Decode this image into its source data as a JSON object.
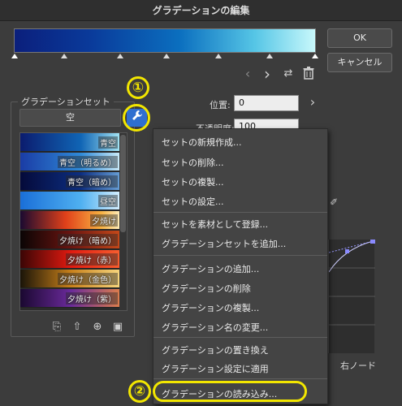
{
  "window": {
    "title": "グラデーションの編集"
  },
  "buttons": {
    "ok": "OK",
    "cancel": "キャンセル"
  },
  "toolbar_icons": [
    "chevron-left-icon",
    "chevron-right-icon",
    "swap-icon",
    "trash-icon"
  ],
  "gradient_set": {
    "label": "グラデーションセット",
    "selected_preset": "空",
    "items": [
      {
        "label": "青空"
      },
      {
        "label": "青空（明るめ）"
      },
      {
        "label": "青空（暗め）"
      },
      {
        "label": "昼空"
      },
      {
        "label": "夕焼け"
      },
      {
        "label": "夕焼け（暗め）"
      },
      {
        "label": "夕焼け（赤）"
      },
      {
        "label": "夕焼け（金色）"
      },
      {
        "label": "夕焼け（紫）"
      }
    ],
    "bottom_icons": [
      "duplicate-icon",
      "import-icon",
      "add-icon",
      "settings-icon"
    ]
  },
  "fields": {
    "position_label": "位置:",
    "position_value": "0",
    "opacity_label": "不透明度:",
    "opacity_value": "100"
  },
  "right_node_label": "右ノード",
  "context_menu": {
    "groups": [
      [
        "セットの新規作成...",
        "セットの削除...",
        "セットの複製...",
        "セットの設定..."
      ],
      [
        "セットを素材として登録...",
        "グラデーションセットを追加..."
      ],
      [
        "グラデーションの追加...",
        "グラデーションの削除",
        "グラデーションの複製...",
        "グラデーション名の変更..."
      ],
      [
        "グラデーションの置き換え",
        "グラデーション設定に適用"
      ],
      [
        "グラデーションの読み込み..."
      ]
    ]
  },
  "annotations": {
    "step1": "①",
    "step2": "②"
  },
  "colors": {
    "accent_yellow": "#f2e600",
    "wrench_blue": "#2f6fd0"
  }
}
